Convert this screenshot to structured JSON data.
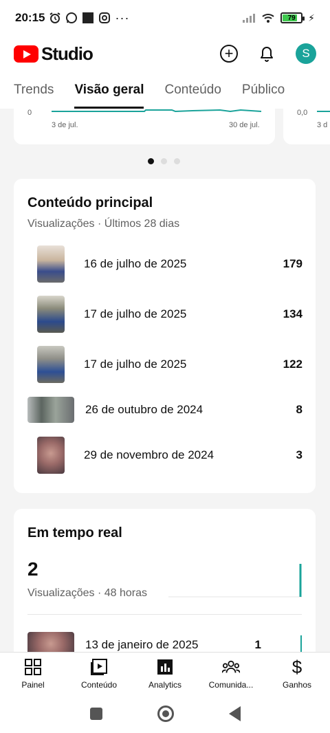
{
  "status_bar": {
    "time": "20:15",
    "battery_level": "79",
    "battery_fraction": 0.79
  },
  "app": {
    "logo_text": "Studio",
    "brand_color": "#ff0000",
    "avatar_letter": "S",
    "avatar_color": "#1aa39a"
  },
  "tabs": [
    {
      "label": "Trends"
    },
    {
      "label": "Visão geral",
      "active": true
    },
    {
      "label": "Conteúdo"
    },
    {
      "label": "Público"
    }
  ],
  "overview_chart": {
    "y_min_label": "0",
    "x_start_label": "3 de jul.",
    "x_end_label": "30 de jul."
  },
  "overview_chart_2": {
    "y_min_label": "0,0",
    "x_start_label": "3 d"
  },
  "pager": {
    "pages": 3,
    "active": 0
  },
  "top_content": {
    "title": "Conteúdo principal",
    "subtitle": "Visualizações · Últimos 28 dias",
    "items": [
      {
        "title": "16 de julho de 2025",
        "views": "179"
      },
      {
        "title": "17 de julho de 2025",
        "views": "134"
      },
      {
        "title": "17 de julho de 2025",
        "views": "122"
      },
      {
        "title": "26 de outubro de 2024",
        "views": "8"
      },
      {
        "title": "29 de novembro de 2024",
        "views": "3"
      }
    ]
  },
  "realtime": {
    "title": "Em tempo real",
    "count": "2",
    "subtitle": "Visualizações · 48 horas",
    "items": [
      {
        "title": "13 de janeiro de 2025",
        "views": "1"
      }
    ]
  },
  "bottom_nav": [
    {
      "label": "Painel",
      "icon": "dashboard-icon"
    },
    {
      "label": "Conteúdo",
      "icon": "content-icon"
    },
    {
      "label": "Analytics",
      "icon": "analytics-icon",
      "active": true
    },
    {
      "label": "Comunida...",
      "icon": "community-icon"
    },
    {
      "label": "Ganhos",
      "icon": "earn-icon"
    }
  ],
  "colors": {
    "chart_line": "#1aa39a",
    "muted_text": "#606060"
  }
}
